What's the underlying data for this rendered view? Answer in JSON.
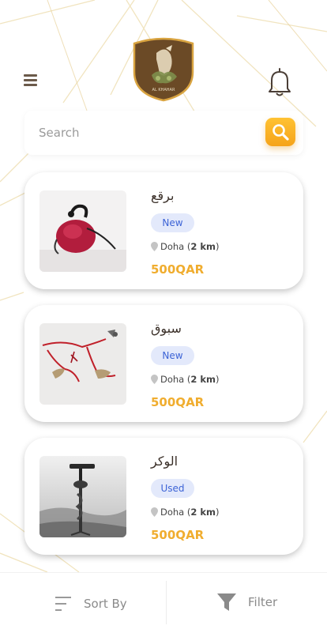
{
  "colors": {
    "accent": "#f5a31a",
    "price": "#f0ad2f",
    "badge_bg": "#e3e9fb",
    "badge_text": "#3c63d6",
    "logo_bg": "#6b4a26",
    "logo_border": "#d9a441"
  },
  "header": {
    "menu_icon": "hamburger-icon",
    "logo_text": "AL KHAHAR",
    "bell_icon": "bell-icon"
  },
  "search": {
    "placeholder": "Search",
    "value": "",
    "button_icon": "search-icon"
  },
  "listings": [
    {
      "title": "برقع",
      "condition": "New",
      "city": "Doha",
      "distance": "2 km",
      "price": "500QAR",
      "image": "falcon-hood-photo"
    },
    {
      "title": "سبوق",
      "condition": "New",
      "city": "Doha",
      "distance": "2 km",
      "price": "500QAR",
      "image": "falcon-jesses-photo"
    },
    {
      "title": "الوكر",
      "condition": "Used",
      "city": "Doha",
      "distance": "2 km",
      "price": "500QAR",
      "image": "falcon-perch-photo"
    }
  ],
  "bottom": {
    "sort_label": "Sort By",
    "sort_icon": "sort-lines-icon",
    "filter_label": "Filter",
    "filter_icon": "funnel-icon"
  }
}
